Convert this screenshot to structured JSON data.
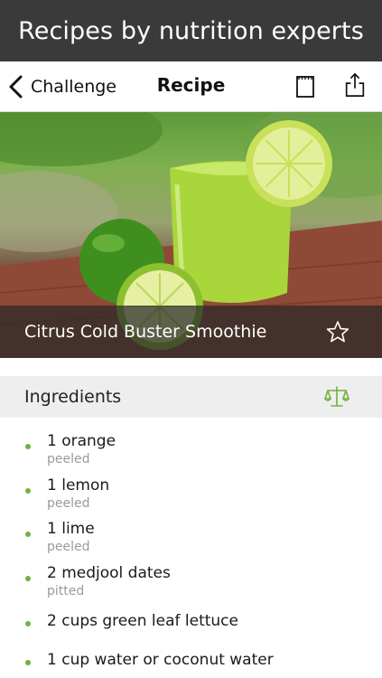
{
  "banner": {
    "text": "Recipes by nutrition experts"
  },
  "navbar": {
    "back_label": "Challenge",
    "title": "Recipe",
    "icons": [
      "chevron-left-icon",
      "notepad-icon",
      "share-icon"
    ]
  },
  "hero": {
    "recipe_title": "Citrus Cold Buster Smoothie",
    "favorite_icon": "star-outline-icon"
  },
  "ingredients_section": {
    "title": "Ingredients",
    "scale_icon": "balance-scale-icon",
    "accent_color": "#6fb33f",
    "items": [
      {
        "name": "1 orange",
        "note": "peeled"
      },
      {
        "name": "1 lemon",
        "note": "peeled"
      },
      {
        "name": "1 lime",
        "note": "peeled"
      },
      {
        "name": "2 medjool dates",
        "note": "pitted"
      },
      {
        "name": "2 cups green leaf lettuce",
        "note": ""
      },
      {
        "name": "1 cup water or coconut water",
        "note": ""
      }
    ]
  }
}
